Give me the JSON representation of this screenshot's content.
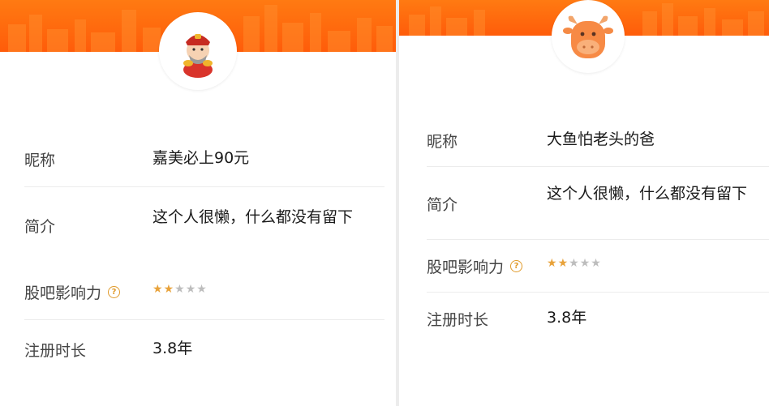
{
  "left_profile": {
    "avatar_icon": "caishen-god-of-wealth-icon",
    "rows": [
      {
        "label": "昵称",
        "value": "嘉美必上90元"
      },
      {
        "label": "简介",
        "value": "这个人很懒，什么都没有留下"
      },
      {
        "label": "股吧影响力",
        "help_icon": "question-circle-icon",
        "value": "",
        "rating": 2,
        "rating_max": 5
      },
      {
        "label": "注册时长",
        "value": "3.8年"
      }
    ]
  },
  "right_profile": {
    "avatar_icon": "orange-ox-head-icon",
    "rows": [
      {
        "label": "昵称",
        "value": "大鱼怕老头的爸"
      },
      {
        "label": "简介",
        "value": "这个人很懒，什么都没有留下"
      },
      {
        "label": "股吧影响力",
        "help_icon": "question-circle-icon",
        "value": "",
        "rating": 2,
        "rating_max": 5
      },
      {
        "label": "注册时长",
        "value": "3.8年"
      }
    ]
  },
  "colors": {
    "banner": "#ff6a0f",
    "star_on": "#e8a23a",
    "star_off": "#bdbdbd",
    "help_icon": "#e09a2a"
  }
}
